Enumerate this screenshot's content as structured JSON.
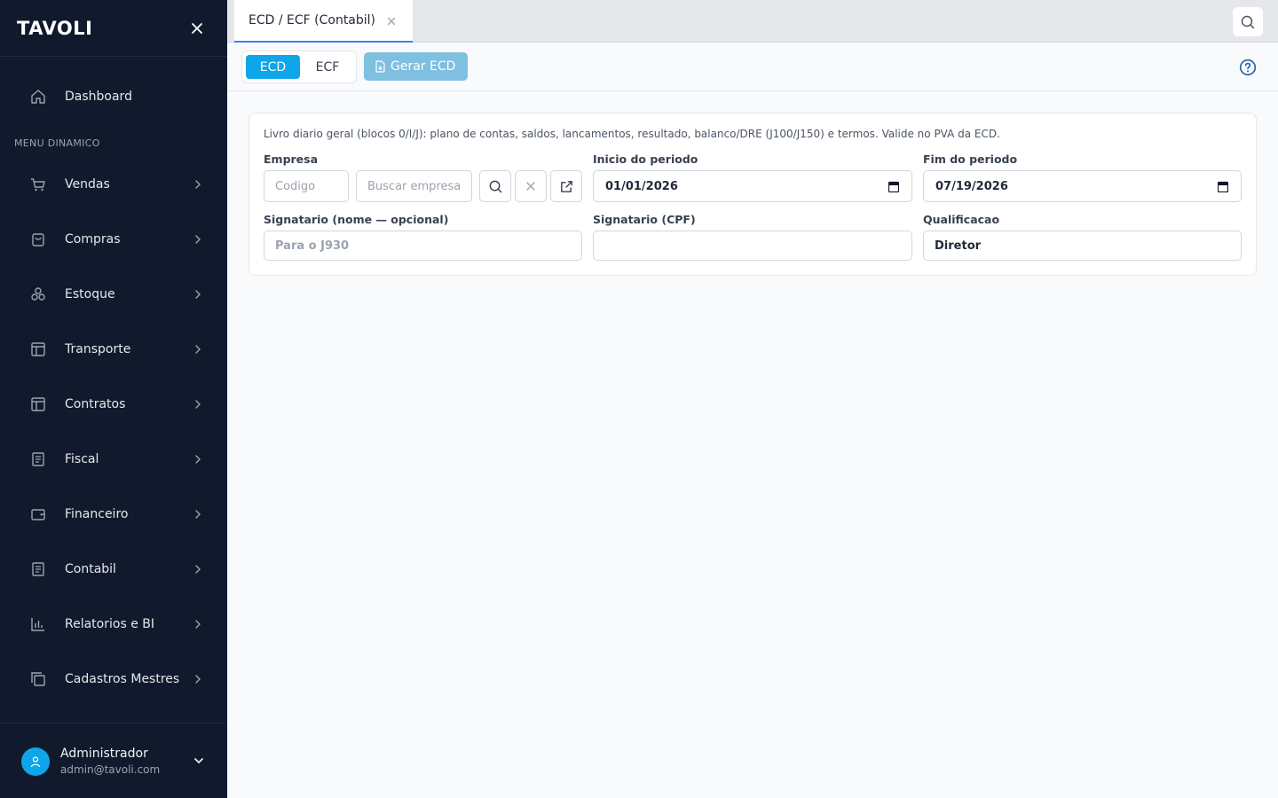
{
  "sidebar": {
    "logo": "TAVOLI",
    "dashboard_label": "Dashboard",
    "section_label": "MENU DINAMICO",
    "items": [
      {
        "label": "Vendas",
        "icon": "cart-icon"
      },
      {
        "label": "Compras",
        "icon": "shopping-bag-icon"
      },
      {
        "label": "Estoque",
        "icon": "boxes-icon"
      },
      {
        "label": "Transporte",
        "icon": "layout-icon"
      },
      {
        "label": "Contratos",
        "icon": "layout-icon"
      },
      {
        "label": "Fiscal",
        "icon": "receipt-icon"
      },
      {
        "label": "Financeiro",
        "icon": "wallet-icon"
      },
      {
        "label": "Contabil",
        "icon": "receipt-icon"
      },
      {
        "label": "Relatorios e BI",
        "icon": "bar-chart-icon"
      },
      {
        "label": "Cadastros Mestres",
        "icon": "copy-icon"
      }
    ],
    "user": {
      "name": "Administrador",
      "email": "admin@tavoli.com"
    }
  },
  "tabs": [
    {
      "label": "ECD / ECF (Contabil)"
    }
  ],
  "toolbar": {
    "segments": [
      "ECD",
      "ECF"
    ],
    "active_segment": "ECD",
    "generate_label": "Gerar ECD"
  },
  "form": {
    "description": "Livro diario geral (blocos 0/I/J): plano de contas, saldos, lancamentos, resultado, balanco/DRE (J100/J150) e termos. Valide no PVA da ECD.",
    "empresa_label": "Empresa",
    "codigo_placeholder": "Codigo",
    "buscar_placeholder": "Buscar empresa",
    "inicio_label": "Inicio do periodo",
    "inicio_value": "01/01/2026",
    "fim_label": "Fim do periodo",
    "fim_value": "07/19/2026",
    "signatario_nome_label": "Signatario (nome — opcional)",
    "signatario_nome_placeholder": "Para o J930",
    "signatario_cpf_label": "Signatario (CPF)",
    "signatario_cpf_value": "",
    "qualificacao_label": "Qualificacao",
    "qualificacao_value": "Diretor"
  },
  "colors": {
    "sidebar_bg": "#111a2c",
    "accent": "#0ea5e9",
    "tab_underline": "#3b82f6",
    "generate_button": "#7fbfe0"
  }
}
